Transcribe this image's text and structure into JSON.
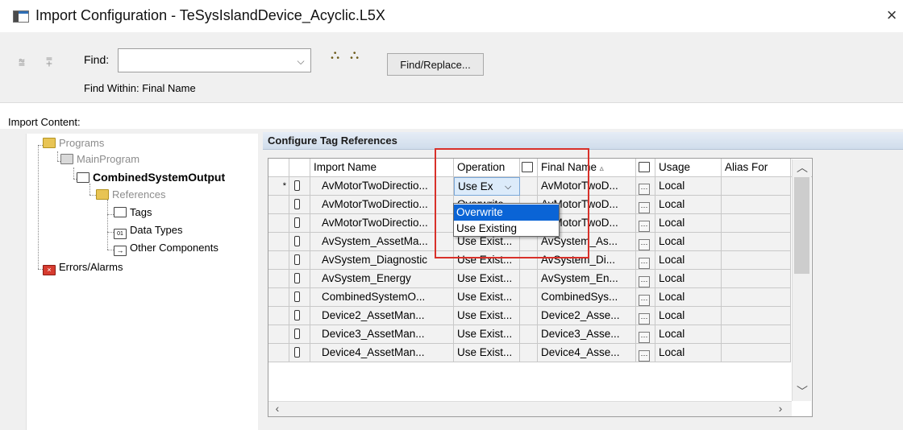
{
  "window": {
    "title": "Import Configuration - TeSysIslandDevice_Acyclic.L5X",
    "close": "×"
  },
  "toolbar": {
    "find_label": "Find:",
    "find_value": "",
    "find_dropdown": "⌵",
    "find_replace_label": "Find/Replace...",
    "find_within": "Find Within: Final Name",
    "icons": [
      "scope-up-icon",
      "scope-down-icon",
      "find-previous-icon",
      "find-next-icon"
    ]
  },
  "import_content_label": "Import Content:",
  "tree": {
    "programs": "Programs",
    "main_program": "MainProgram",
    "combined": "CombinedSystemOutput",
    "references": "References",
    "tags": "Tags",
    "data_types": "Data Types",
    "other_components": "Other Components",
    "errors": "Errors/Alarms"
  },
  "section_title": "Configure Tag References",
  "grid": {
    "headers": {
      "import_name": "Import Name",
      "operation": "Operation",
      "final_name": "Final Name",
      "sort": "▵",
      "usage": "Usage",
      "alias_for": "Alias For"
    },
    "rows": [
      {
        "star": "*",
        "import_name": "AvMotorTwoDirectio...",
        "operation": "Use Ex",
        "final_name": "AvMotorTwoD...",
        "usage": "Local",
        "alias": ""
      },
      {
        "star": "",
        "import_name": "AvMotorTwoDirectio...",
        "operation": "Overwrite",
        "final_name": "AvMotorTwoD...",
        "usage": "Local",
        "alias": ""
      },
      {
        "star": "",
        "import_name": "AvMotorTwoDirectio...",
        "operation": "Use Existing",
        "final_name": "AvMotorTwoD...",
        "usage": "Local",
        "alias": ""
      },
      {
        "star": "",
        "import_name": "AvSystem_AssetMa...",
        "operation": "Use Exist...",
        "final_name": "AvSystem_As...",
        "usage": "Local",
        "alias": ""
      },
      {
        "star": "",
        "import_name": "AvSystem_Diagnostic",
        "operation": "Use Exist...",
        "final_name": "AvSystem_Di...",
        "usage": "Local",
        "alias": ""
      },
      {
        "star": "",
        "import_name": "AvSystem_Energy",
        "operation": "Use Exist...",
        "final_name": "AvSystem_En...",
        "usage": "Local",
        "alias": ""
      },
      {
        "star": "",
        "import_name": "CombinedSystemO...",
        "operation": "Use Exist...",
        "final_name": "CombinedSys...",
        "usage": "Local",
        "alias": ""
      },
      {
        "star": "",
        "import_name": "Device2_AssetMan...",
        "operation": "Use Exist...",
        "final_name": "Device2_Asse...",
        "usage": "Local",
        "alias": ""
      },
      {
        "star": "",
        "import_name": "Device3_AssetMan...",
        "operation": "Use Exist...",
        "final_name": "Device3_Asse...",
        "usage": "Local",
        "alias": ""
      },
      {
        "star": "",
        "import_name": "Device4_AssetMan...",
        "operation": "Use Exist...",
        "final_name": "Device4_Asse...",
        "usage": "Local",
        "alias": ""
      }
    ]
  },
  "dropdown": {
    "options": [
      "Overwrite",
      "Use Existing"
    ],
    "selected": "Overwrite",
    "current_value": "Use Ex"
  },
  "colors": {
    "highlight_box": "#d8312a",
    "selection": "#0a64d6"
  }
}
